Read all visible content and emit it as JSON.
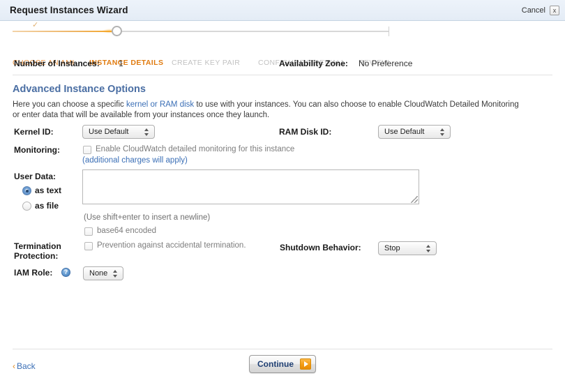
{
  "window": {
    "title": "Request Instances Wizard",
    "cancel_label": "Cancel",
    "close_glyph": "x"
  },
  "wizard_steps": [
    {
      "label": "CHOOSE AN AMI",
      "state": "done"
    },
    {
      "label": "INSTANCE DETAILS",
      "state": "active"
    },
    {
      "label": "CREATE KEY PAIR",
      "state": "todo"
    },
    {
      "label": "CONFIGURE FIREWALL",
      "state": "todo"
    },
    {
      "label": "REVIEW",
      "state": "todo"
    }
  ],
  "summary": {
    "instances_label": "Number of Instances:",
    "instances_value": "1",
    "zone_label": "Availability Zone:",
    "zone_value": "No Preference"
  },
  "section": {
    "heading": "Advanced Instance Options",
    "intro_part1": "Here you can choose a specific ",
    "intro_link": "kernel or RAM disk",
    "intro_part2": " to use with your instances. You can also choose to enable CloudWatch Detailed Monitoring or enter data that will be available from your instances once they launch."
  },
  "fields": {
    "kernel_label": "Kernel ID:",
    "kernel_value": "Use Default",
    "ramdisk_label": "RAM Disk ID:",
    "ramdisk_value": "Use Default",
    "monitoring_label": "Monitoring:",
    "monitoring_checkbox_label": "Enable CloudWatch detailed monitoring for this instance",
    "monitoring_note": "(additional charges will apply)",
    "userdata_label": "User Data:",
    "userdata_as_text": "as text",
    "userdata_as_file": "as file",
    "userdata_value": "",
    "userdata_hint": "(Use shift+enter to insert a newline)",
    "base64_label": "base64 encoded",
    "termination_label_line1": "Termination",
    "termination_label_line2": "Protection:",
    "termination_checkbox_label": "Prevention against accidental termination.",
    "shutdown_label": "Shutdown Behavior:",
    "shutdown_value": "Stop",
    "iam_label": "IAM Role:",
    "iam_help_glyph": "?",
    "iam_value": "None"
  },
  "footer": {
    "back_label": "Back",
    "back_chevron": "‹",
    "continue_label": "Continue"
  },
  "colors": {
    "accent_orange": "#e07b10",
    "link_blue": "#3b6fb6",
    "heading_blue": "#4a6ea3",
    "titlebar_bg": "#e8f0f8"
  }
}
